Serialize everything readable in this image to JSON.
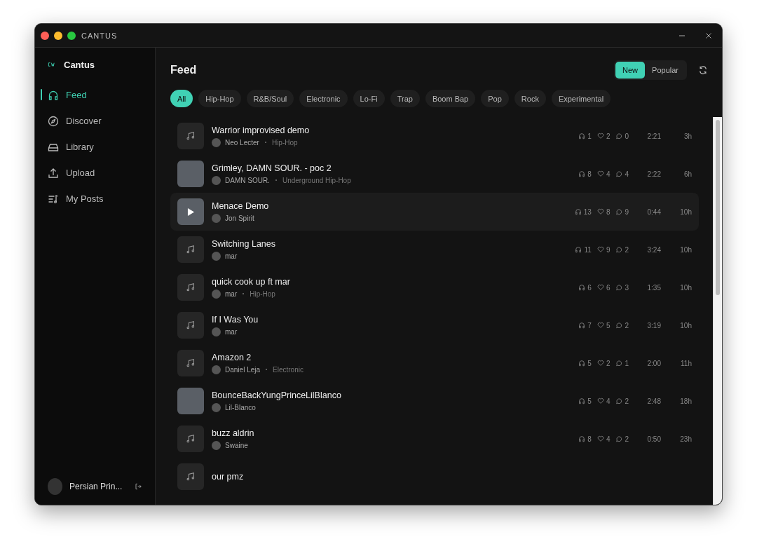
{
  "window": {
    "title": "CANTUS"
  },
  "sidebar": {
    "brand": "Cantus",
    "items": [
      {
        "label": "Feed",
        "kind": "headphones",
        "selected": true
      },
      {
        "label": "Discover",
        "kind": "compass",
        "selected": false
      },
      {
        "label": "Library",
        "kind": "drive",
        "selected": false
      },
      {
        "label": "Upload",
        "kind": "upload",
        "selected": false
      },
      {
        "label": "My Posts",
        "kind": "list",
        "selected": false
      }
    ],
    "user": {
      "name": "Persian Prin..."
    }
  },
  "feed": {
    "title": "Feed",
    "sort": [
      {
        "label": "New",
        "selected": true
      },
      {
        "label": "Popular",
        "selected": false
      }
    ],
    "genres": [
      {
        "label": "All",
        "selected": true
      },
      {
        "label": "Hip-Hop",
        "selected": false
      },
      {
        "label": "R&B/Soul",
        "selected": false
      },
      {
        "label": "Electronic",
        "selected": false
      },
      {
        "label": "Lo-Fi",
        "selected": false
      },
      {
        "label": "Trap",
        "selected": false
      },
      {
        "label": "Boom Bap",
        "selected": false
      },
      {
        "label": "Pop",
        "selected": false
      },
      {
        "label": "Rock",
        "selected": false
      },
      {
        "label": "Experimental",
        "selected": false
      }
    ],
    "tracks": [
      {
        "title": "Warrior improvised demo",
        "artist": "Neo Lecter",
        "genre": "Hip-Hop",
        "kind": "note",
        "hovered": false,
        "plays": "1",
        "likes": "2",
        "comments": "0",
        "duration": "2:21",
        "age": "3h"
      },
      {
        "title": "Grimley, DAMN SOUR. - poc 2",
        "artist": "DAMN SOUR.",
        "genre": "Underground Hip-Hop",
        "kind": "photo",
        "hovered": false,
        "plays": "8",
        "likes": "4",
        "comments": "4",
        "duration": "2:22",
        "age": "6h"
      },
      {
        "title": "Menace Demo",
        "artist": "Jon Spirit",
        "kind": "photo",
        "hovered": true,
        "plays": "13",
        "likes": "8",
        "comments": "9",
        "duration": "0:44",
        "age": "10h"
      },
      {
        "title": "Switching Lanes",
        "artist": "mar",
        "kind": "note",
        "hovered": false,
        "plays": "11",
        "likes": "9",
        "comments": "2",
        "duration": "3:24",
        "age": "10h"
      },
      {
        "title": "quick cook up ft mar",
        "artist": "mar",
        "genre": "Hip-Hop",
        "kind": "note",
        "hovered": false,
        "plays": "6",
        "likes": "6",
        "comments": "3",
        "duration": "1:35",
        "age": "10h"
      },
      {
        "title": "If I Was You",
        "artist": "mar",
        "kind": "note",
        "hovered": false,
        "plays": "7",
        "likes": "5",
        "comments": "2",
        "duration": "3:19",
        "age": "10h"
      },
      {
        "title": "Amazon 2",
        "artist": "Daniel Leja",
        "genre": "Electronic",
        "kind": "note",
        "hovered": false,
        "plays": "5",
        "likes": "2",
        "comments": "1",
        "duration": "2:00",
        "age": "11h"
      },
      {
        "title": "BounceBackYungPrinceLilBlanco",
        "artist": "Lil-Blanco",
        "kind": "photo",
        "hovered": false,
        "plays": "5",
        "likes": "4",
        "comments": "2",
        "duration": "2:48",
        "age": "18h"
      },
      {
        "title": "buzz aldrin",
        "artist": "Swaine",
        "kind": "note",
        "hovered": false,
        "plays": "8",
        "likes": "4",
        "comments": "2",
        "duration": "0:50",
        "age": "23h"
      },
      {
        "title": "our pmz",
        "kind": "note",
        "hovered": false
      }
    ]
  }
}
